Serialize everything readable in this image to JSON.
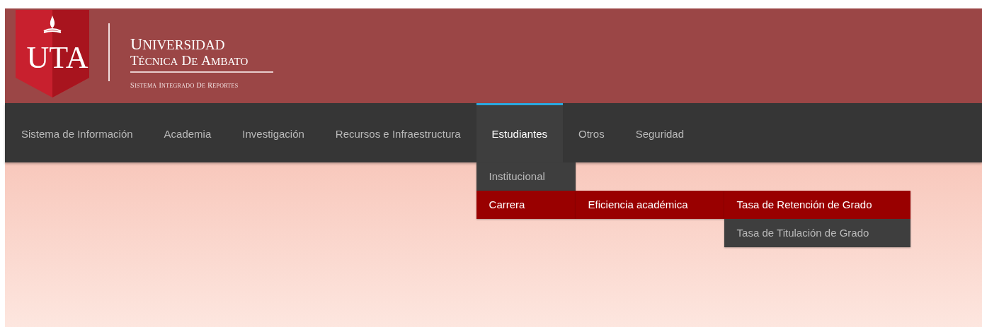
{
  "header": {
    "logo_text": "UTA",
    "title_lines": [
      "UNIVERSIDAD",
      "TÉCNICA DE AMBATO"
    ],
    "subtitle": "SISTEMA INTEGRADO DE REPORTES"
  },
  "nav": {
    "items": [
      {
        "label": "Sistema de Información",
        "selected": false
      },
      {
        "label": "Academia",
        "selected": false
      },
      {
        "label": "Investigación",
        "selected": false
      },
      {
        "label": "Recursos e Infraestructura",
        "selected": false
      },
      {
        "label": "Estudiantes",
        "selected": true,
        "children": [
          {
            "label": "Institucional",
            "selected": false
          },
          {
            "label": "Carrera",
            "selected": true,
            "children": [
              {
                "label": "Eficiencia académica",
                "selected": true,
                "children": [
                  {
                    "label": "Tasa de Retención de Grado",
                    "selected": true
                  },
                  {
                    "label": "Tasa de Titulación de Grado",
                    "selected": false
                  }
                ]
              }
            ]
          }
        ]
      },
      {
        "label": "Otros",
        "selected": false
      },
      {
        "label": "Seguridad",
        "selected": false
      }
    ]
  }
}
